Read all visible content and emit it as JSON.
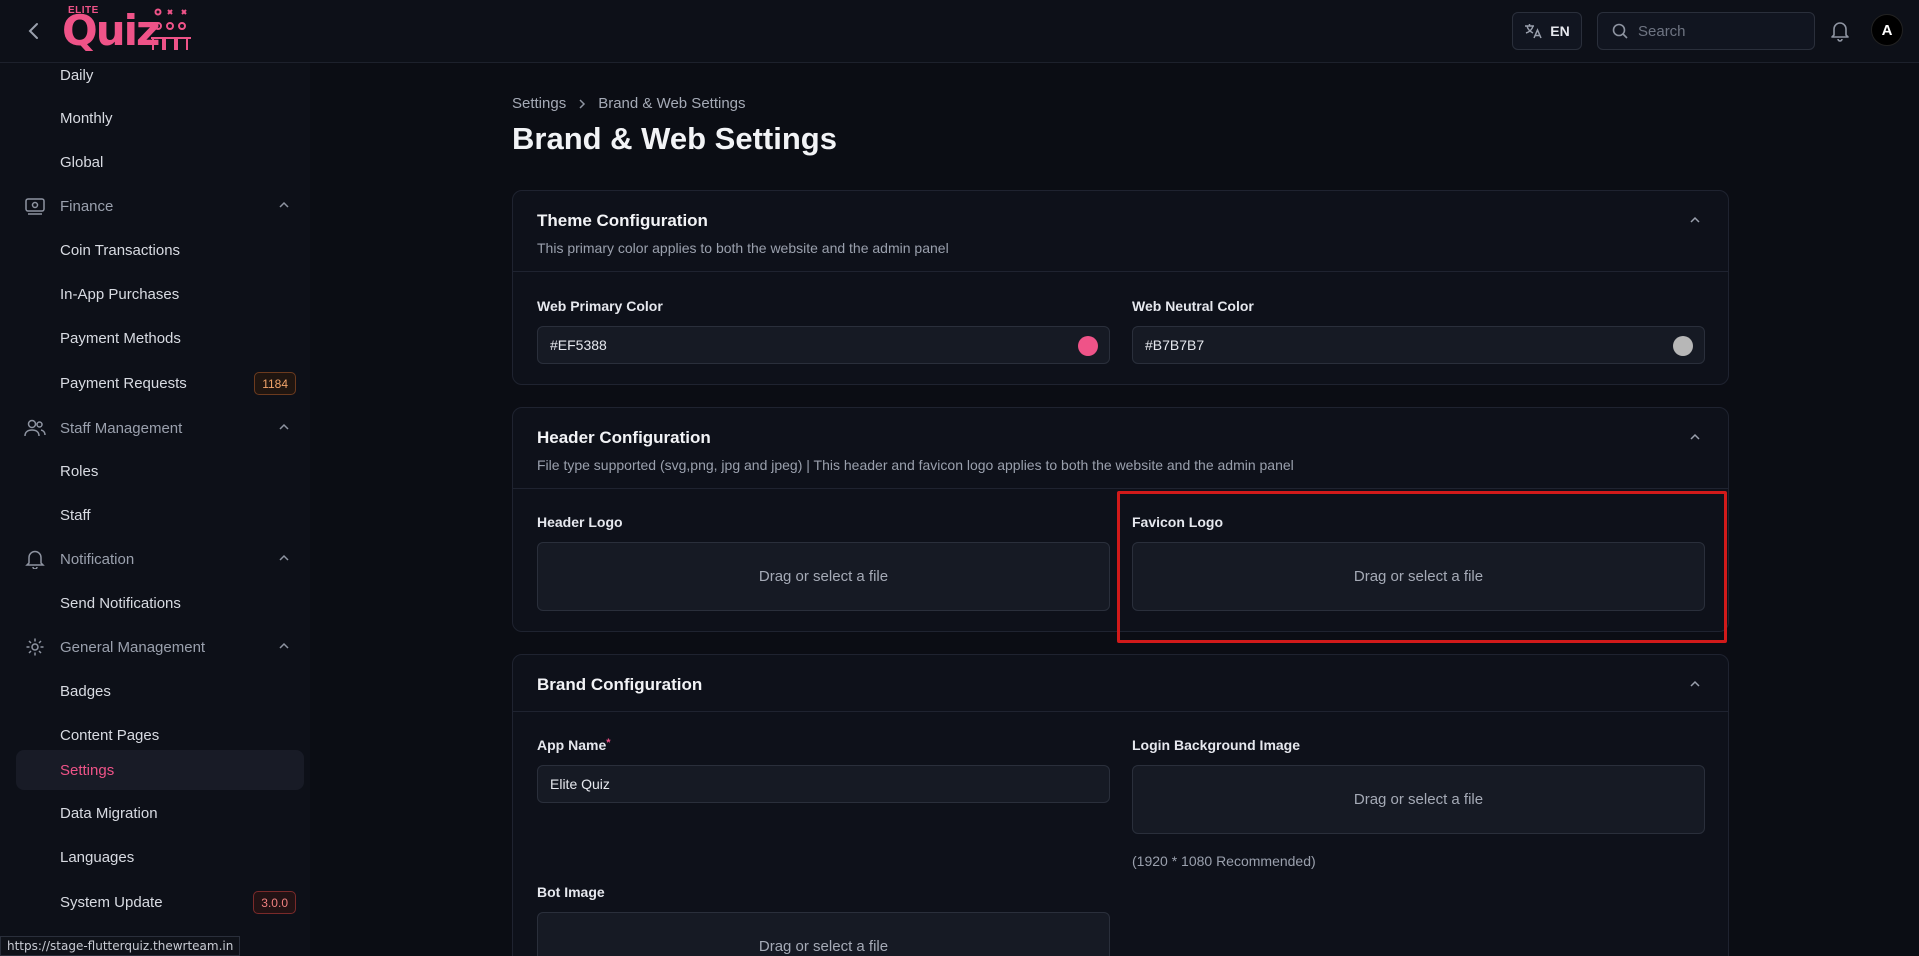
{
  "header": {
    "logo_small": "ELITE",
    "logo_main": "Quiz",
    "lang": "EN",
    "search_placeholder": "Search",
    "avatar_initial": "A"
  },
  "sidebar": {
    "items": [
      {
        "label": "Daily",
        "type": "sub"
      },
      {
        "label": "Monthly",
        "type": "sub"
      },
      {
        "label": "Global",
        "type": "sub"
      },
      {
        "label": "Finance",
        "type": "group",
        "icon": "finance-icon"
      },
      {
        "label": "Coin Transactions",
        "type": "sub"
      },
      {
        "label": "In-App Purchases",
        "type": "sub"
      },
      {
        "label": "Payment Methods",
        "type": "sub"
      },
      {
        "label": "Payment Requests",
        "type": "sub",
        "badge": "1184"
      },
      {
        "label": "Staff Management",
        "type": "group",
        "icon": "users-icon"
      },
      {
        "label": "Roles",
        "type": "sub"
      },
      {
        "label": "Staff",
        "type": "sub"
      },
      {
        "label": "Notification",
        "type": "group",
        "icon": "bell-icon"
      },
      {
        "label": "Send Notifications",
        "type": "sub"
      },
      {
        "label": "General Management",
        "type": "group",
        "icon": "gear-icon"
      },
      {
        "label": "Badges",
        "type": "sub"
      },
      {
        "label": "Content Pages",
        "type": "sub"
      },
      {
        "label": "Settings",
        "type": "sub",
        "active": true
      },
      {
        "label": "Data Migration",
        "type": "sub"
      },
      {
        "label": "Languages",
        "type": "sub"
      },
      {
        "label": "System Update",
        "type": "sub",
        "badge": "3.0.0"
      }
    ]
  },
  "status_url": "https://stage-flutterquiz.thewrteam.in",
  "breadcrumb": {
    "root": "Settings",
    "current": "Brand & Web Settings"
  },
  "page_title": "Brand & Web Settings",
  "theme": {
    "title": "Theme Configuration",
    "desc": "This primary color applies to both the website and the admin panel",
    "primary_label": "Web Primary Color",
    "primary_value": "#EF5388",
    "neutral_label": "Web Neutral Color",
    "neutral_value": "#B7B7B7"
  },
  "header_cfg": {
    "title": "Header Configuration",
    "desc": "File type supported (svg,png, jpg and jpeg) | This header and favicon logo applies to both the website and the admin panel",
    "header_logo_label": "Header Logo",
    "favicon_logo_label": "Favicon Logo",
    "drop_text": "Drag or select a file"
  },
  "brand": {
    "title": "Brand Configuration",
    "app_name_label": "App Name",
    "app_name_required": "*",
    "app_name_value": "Elite Quiz",
    "login_bg_label": "Login Background Image",
    "login_bg_hint": "(1920 * 1080 Recommended)",
    "bot_image_label": "Bot Image",
    "drop_text": "Drag or select a file"
  },
  "colors": {
    "accent": "#EF5388",
    "neutral": "#B7B7B7",
    "highlight": "#D11A1A"
  }
}
